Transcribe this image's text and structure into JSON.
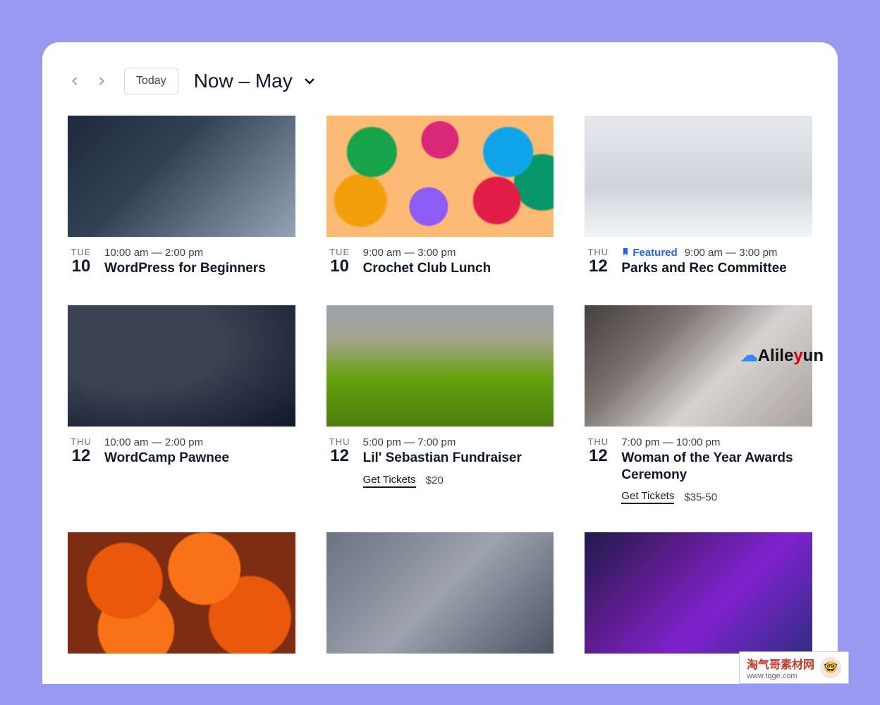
{
  "toolbar": {
    "today_label": "Today",
    "range_label": "Now – May"
  },
  "events": [
    {
      "weekday": "TUE",
      "day": "10",
      "time": "10:00 am — 2:00 pm",
      "title": "WordPress for Beginners",
      "featured": false,
      "thumb_class": "bg-workshop"
    },
    {
      "weekday": "TUE",
      "day": "10",
      "time": "9:00 am — 3:00 pm",
      "title": "Crochet Club Lunch",
      "featured": false,
      "thumb_class": "bg-yarn"
    },
    {
      "weekday": "THU",
      "day": "12",
      "time": "9:00 am — 3:00 pm",
      "title": "Parks and Rec Committee",
      "featured": true,
      "featured_label": "Featured",
      "thumb_class": "bg-meeting"
    },
    {
      "weekday": "THU",
      "day": "12",
      "time": "10:00 am — 2:00 pm",
      "title": "WordCamp Pawnee",
      "featured": false,
      "thumb_class": "bg-stage"
    },
    {
      "weekday": "THU",
      "day": "12",
      "time": "5:00 pm — 7:00 pm",
      "title": "Lil' Sebastian Fundraiser",
      "featured": false,
      "tickets_label": "Get Tickets",
      "price": "$20",
      "thumb_class": "bg-pony"
    },
    {
      "weekday": "THU",
      "day": "12",
      "time": "7:00 pm — 10:00 pm",
      "title": "Woman of the Year Awards Ceremony",
      "featured": false,
      "tickets_label": "Get Tickets",
      "price": "$35-50",
      "thumb_class": "bg-toast"
    },
    {
      "weekday": "",
      "day": "",
      "time": "",
      "title": "",
      "featured": false,
      "thumb_class": "bg-pumpkin"
    },
    {
      "weekday": "",
      "day": "",
      "time": "",
      "title": "",
      "featured": false,
      "thumb_class": "bg-medieval"
    },
    {
      "weekday": "",
      "day": "",
      "time": "",
      "title": "",
      "featured": false,
      "thumb_class": "bg-party"
    }
  ],
  "watermarks": {
    "alileyun": "Alileyun",
    "site_cn": "淘气哥素材网",
    "site_url": "www.tqge.com"
  }
}
